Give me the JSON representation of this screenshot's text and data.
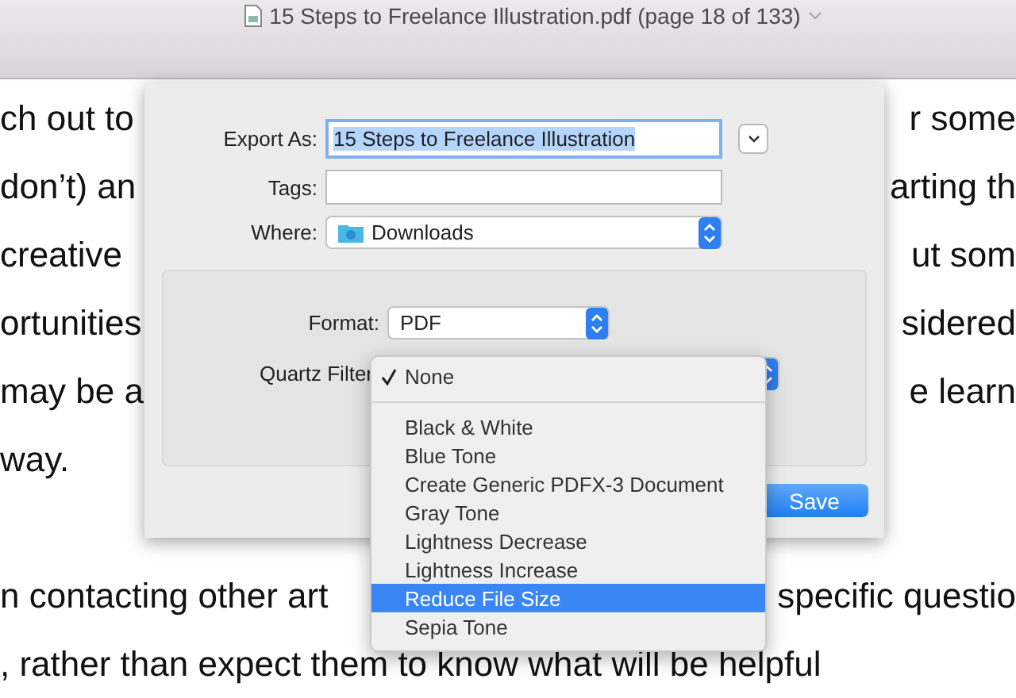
{
  "window": {
    "title": "15 Steps to Freelance Illustration.pdf (page 18 of 133)"
  },
  "document": {
    "lines": [
      {
        "left": "ch out to",
        "right": "r some"
      },
      {
        "left": "don’t) an",
        "right": "arting th"
      },
      {
        "left": "creative",
        "right": "ut som"
      },
      {
        "left": "ortunities",
        "right": "sidered"
      },
      {
        "left": "may be a",
        "right": "e learn"
      },
      {
        "left": "way."
      },
      {
        "left": "n contacting other art",
        "right": "specific questio",
        "paragraph_start": true
      },
      {
        "left": ", rather than expect them to know what will be helpful"
      }
    ]
  },
  "export_dialog": {
    "export_as": {
      "label": "Export As:",
      "value": "15 Steps to Freelance Illustration",
      "text_selected": true
    },
    "tags": {
      "label": "Tags:"
    },
    "where": {
      "label": "Where:",
      "value": "Downloads"
    },
    "format": {
      "label": "Format:",
      "value": "PDF"
    },
    "quartz_filter": {
      "label": "Quartz Filter",
      "menu": [
        {
          "kind": "option",
          "label": "None",
          "checked": true,
          "selected": false
        },
        {
          "kind": "separator"
        },
        {
          "kind": "option",
          "label": "Black & White",
          "checked": false,
          "selected": false
        },
        {
          "kind": "option",
          "label": "Blue Tone",
          "checked": false,
          "selected": false
        },
        {
          "kind": "option",
          "label": "Create Generic PDFX-3 Document",
          "checked": false,
          "selected": false
        },
        {
          "kind": "option",
          "label": "Gray Tone",
          "checked": false,
          "selected": false
        },
        {
          "kind": "option",
          "label": "Lightness Decrease",
          "checked": false,
          "selected": false
        },
        {
          "kind": "option",
          "label": "Lightness Increase",
          "checked": false,
          "selected": false
        },
        {
          "kind": "option",
          "label": "Reduce File Size",
          "checked": false,
          "selected": true
        },
        {
          "kind": "option",
          "label": "Sepia Tone",
          "checked": false,
          "selected": false
        }
      ]
    },
    "buttons": [
      {
        "label": "Save",
        "default": true
      }
    ]
  }
}
